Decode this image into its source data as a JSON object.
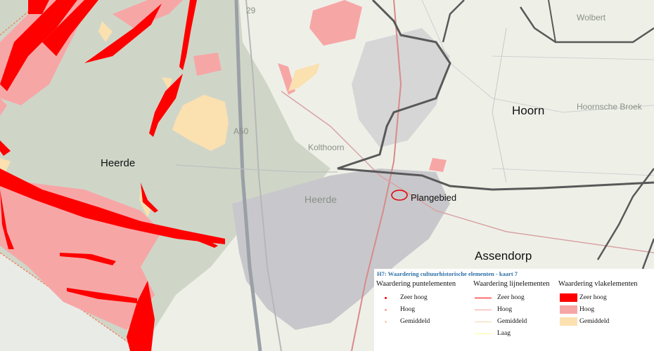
{
  "map": {
    "place_labels": {
      "heerde_region": "Heerde",
      "hoorn": "Hoorn",
      "plangebied": "Plangebied",
      "assendorp": "Assendorp",
      "heerde_town": "Heerde",
      "a50": "A50",
      "hoornsche_broek": "Hoornsche Broek",
      "wolbert": "Wolbert",
      "kolthoorn": "Kolthoorn"
    },
    "colors": {
      "zeer_hoog": "#ff0000",
      "hoog": "#f7a6a6",
      "gemiddeld": "#fbe0b0",
      "border": "#595959",
      "base_forest": "#cfd6c8",
      "base_field": "#eef0e8",
      "built_up": "#c8c8cc"
    }
  },
  "legend": {
    "title": "H7: Waardering cultuurhistorische elementen - kaart 7",
    "point_elements": {
      "heading": "Waardering puntelementen",
      "items": [
        {
          "label": "Zeer hoog",
          "color": "#ff0000"
        },
        {
          "label": "Hoog",
          "color": "#f4a0a0"
        },
        {
          "label": "Gemiddeld",
          "color": "#f5d6a8"
        }
      ]
    },
    "line_elements": {
      "heading": "Waardering lijnelementen",
      "items": [
        {
          "label": "Zeer hoog",
          "color": "#ff0000"
        },
        {
          "label": "Hoog",
          "color": "#f4a0a0"
        },
        {
          "label": "Gemiddeld",
          "color": "#f5d6a8"
        },
        {
          "label": "Laag",
          "color": "#ffff99"
        }
      ]
    },
    "area_elements": {
      "heading": "Waardering vlakelementen",
      "items": [
        {
          "label": "Zeer hoog",
          "color": "#ff0000"
        },
        {
          "label": "Hoog",
          "color": "#f7a6a6"
        },
        {
          "label": "Gemiddeld",
          "color": "#fbe0b0"
        }
      ]
    }
  }
}
